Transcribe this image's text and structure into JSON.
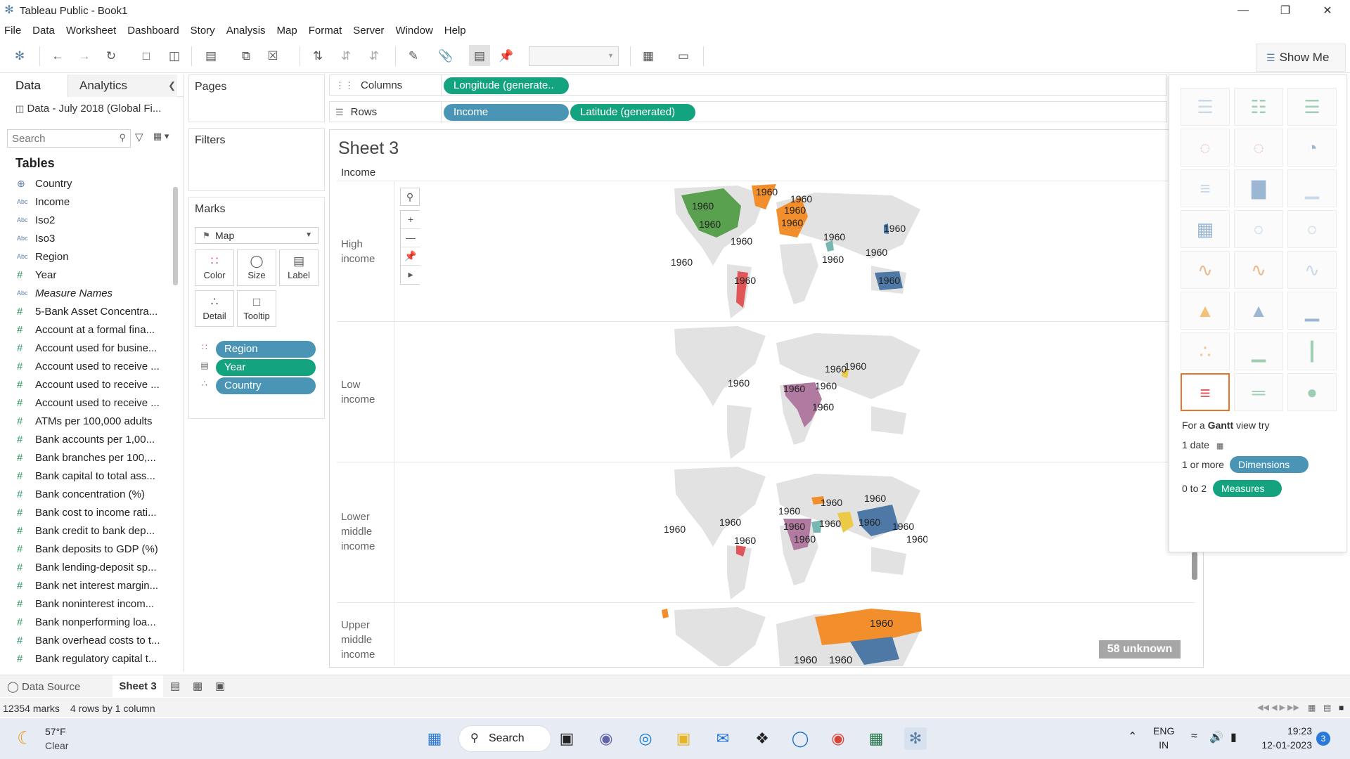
{
  "window": {
    "title": "Tableau Public - Book1"
  },
  "menu": [
    "File",
    "Data",
    "Worksheet",
    "Dashboard",
    "Story",
    "Analysis",
    "Map",
    "Format",
    "Server",
    "Window",
    "Help"
  ],
  "toolbar": {
    "show_me_label": "Show Me"
  },
  "data_pane": {
    "tab_data": "Data",
    "tab_analytics": "Analytics",
    "datasource": "Data - July 2018 (Global Fi...",
    "search_placeholder": "Search",
    "tables_title": "Tables",
    "fields": [
      {
        "type": "geo",
        "name": "Country"
      },
      {
        "type": "abc",
        "name": "Income"
      },
      {
        "type": "abc",
        "name": "Iso2"
      },
      {
        "type": "abc",
        "name": "Iso3"
      },
      {
        "type": "abc",
        "name": "Region"
      },
      {
        "type": "num",
        "name": "Year"
      },
      {
        "type": "abc",
        "name": "Measure Names"
      },
      {
        "type": "num",
        "name": "5-Bank Asset Concentra..."
      },
      {
        "type": "num",
        "name": "Account at a formal fina..."
      },
      {
        "type": "num",
        "name": "Account used for busine..."
      },
      {
        "type": "num",
        "name": "Account used to receive ..."
      },
      {
        "type": "num",
        "name": "Account used to receive ..."
      },
      {
        "type": "num",
        "name": "Account used to receive ..."
      },
      {
        "type": "num",
        "name": "ATMs per 100,000 adults"
      },
      {
        "type": "num",
        "name": "Bank accounts per 1,00..."
      },
      {
        "type": "num",
        "name": "Bank branches per 100,..."
      },
      {
        "type": "num",
        "name": "Bank capital to total ass..."
      },
      {
        "type": "num",
        "name": "Bank concentration (%)"
      },
      {
        "type": "num",
        "name": "Bank cost to income rati..."
      },
      {
        "type": "num",
        "name": "Bank credit to bank dep..."
      },
      {
        "type": "num",
        "name": "Bank deposits to GDP (%)"
      },
      {
        "type": "num",
        "name": "Bank lending-deposit sp..."
      },
      {
        "type": "num",
        "name": "Bank net interest margin..."
      },
      {
        "type": "num",
        "name": "Bank noninterest incom..."
      },
      {
        "type": "num",
        "name": "Bank nonperforming loa..."
      },
      {
        "type": "num",
        "name": "Bank overhead costs to t..."
      },
      {
        "type": "num",
        "name": "Bank regulatory capital t..."
      }
    ]
  },
  "shelves": {
    "pages": "Pages",
    "filters": "Filters",
    "marks": "Marks",
    "mark_type": "Map",
    "mark_buttons": [
      "Color",
      "Size",
      "Label",
      "Detail",
      "Tooltip"
    ],
    "mark_pills": [
      {
        "name": "Region",
        "color": "#4a94b5"
      },
      {
        "name": "Year",
        "color": "#14a37f"
      },
      {
        "name": "Country",
        "color": "#4a94b5"
      }
    ],
    "columns_label": "Columns",
    "rows_label": "Rows",
    "columns_pills": [
      {
        "name": "Longitude (generate..",
        "color": "#14a37f"
      }
    ],
    "rows_pills": [
      {
        "name": "Income",
        "color": "#4a94b5"
      },
      {
        "name": "Latitude (generated)",
        "color": "#14a37f"
      }
    ]
  },
  "sheet": {
    "title": "Sheet 3",
    "column_header": "Income",
    "rows": [
      {
        "label": [
          "High",
          "income"
        ]
      },
      {
        "label": [
          "Low",
          "income"
        ]
      },
      {
        "label": [
          "Lower",
          "middle",
          "income"
        ]
      },
      {
        "label": [
          "Upper",
          "middle",
          "income"
        ]
      }
    ],
    "mark_label": "1960",
    "unknown_badge": "58 unknown",
    "region_colors": {
      "north_america": "#59a14f",
      "europe_central_asia": "#f28e2b",
      "latin_america": "#e15759",
      "east_asia_pacific": "#4e79a7",
      "sub_saharan_africa": "#b07aa1",
      "middle_east_north_africa": "#76b7b2",
      "south_asia": "#edc948"
    }
  },
  "show_me": {
    "hint_prefix": "For a ",
    "hint_bold": "Gantt",
    "hint_suffix": " view try",
    "req1": "1 date",
    "req2_prefix": "1 or more",
    "req2_pill": "Dimensions",
    "req3_prefix": "0 to 2",
    "req3_pill": "Measures"
  },
  "tabs": {
    "data_source": "Data Source",
    "sheet": "Sheet 3"
  },
  "status": {
    "marks": "12354 marks",
    "layout": "4 rows by 1 column"
  },
  "taskbar": {
    "temperature": "57°F",
    "condition": "Clear",
    "search": "Search",
    "lang": "ENG",
    "region": "IN",
    "time": "19:23",
    "date": "12-01-2023",
    "notifications": "3"
  }
}
